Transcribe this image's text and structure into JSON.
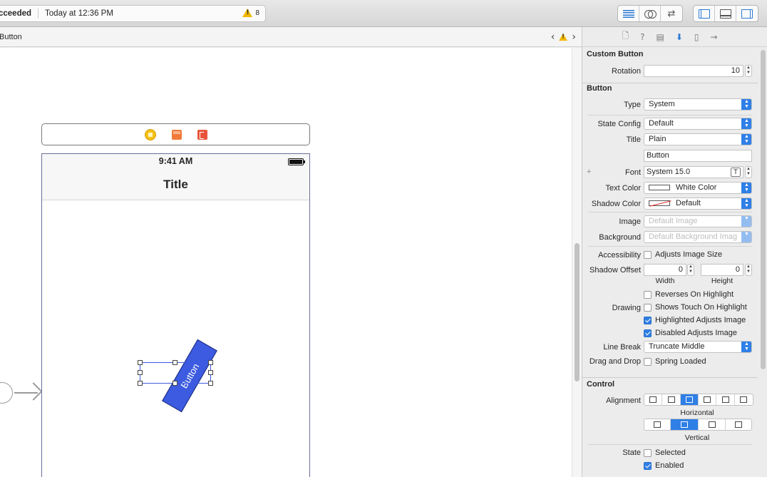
{
  "toolbar": {
    "build_status": "cceeded",
    "build_time": "Today at 12:36 PM",
    "warning_count": "8"
  },
  "jumpbar": {
    "crumb": "Button"
  },
  "scene": {
    "status_time": "9:41 AM",
    "nav_title": "Title",
    "button_label": "Button"
  },
  "inspector": {
    "custom_section": "Custom Button",
    "rotation_label": "Rotation",
    "rotation_value": "10",
    "button_section": "Button",
    "type_label": "Type",
    "type_value": "System",
    "state_config_label": "State Config",
    "state_config_value": "Default",
    "title_label": "Title",
    "title_value": "Plain",
    "title_text": "Button",
    "font_label": "Font",
    "font_value": "System 15.0",
    "text_color_label": "Text Color",
    "text_color_value": "White Color",
    "shadow_color_label": "Shadow Color",
    "shadow_color_value": "Default",
    "image_label": "Image",
    "image_placeholder": "Default Image",
    "background_label": "Background",
    "background_placeholder": "Default Background Imag",
    "accessibility_label": "Accessibility",
    "adjusts_image_size": "Adjusts Image Size",
    "shadow_offset_label": "Shadow Offset",
    "shadow_offset_width": "0",
    "shadow_offset_height": "0",
    "width_label": "Width",
    "height_label": "Height",
    "reverses_on_highlight": "Reverses On Highlight",
    "drawing_label": "Drawing",
    "shows_touch": "Shows Touch On Highlight",
    "highlighted_adjusts": "Highlighted Adjusts Image",
    "disabled_adjusts": "Disabled Adjusts Image",
    "line_break_label": "Line Break",
    "line_break_value": "Truncate Middle",
    "drag_drop_label": "Drag and Drop",
    "spring_loaded": "Spring Loaded",
    "control_section": "Control",
    "alignment_label": "Alignment",
    "horizontal_label": "Horizontal",
    "vertical_label": "Vertical",
    "state_label": "State",
    "selected_label": "Selected",
    "enabled_label": "Enabled"
  },
  "colors": {
    "accent": "#2f7fe6",
    "button_fill": "#3c5be0",
    "warning": "#f2b800"
  }
}
